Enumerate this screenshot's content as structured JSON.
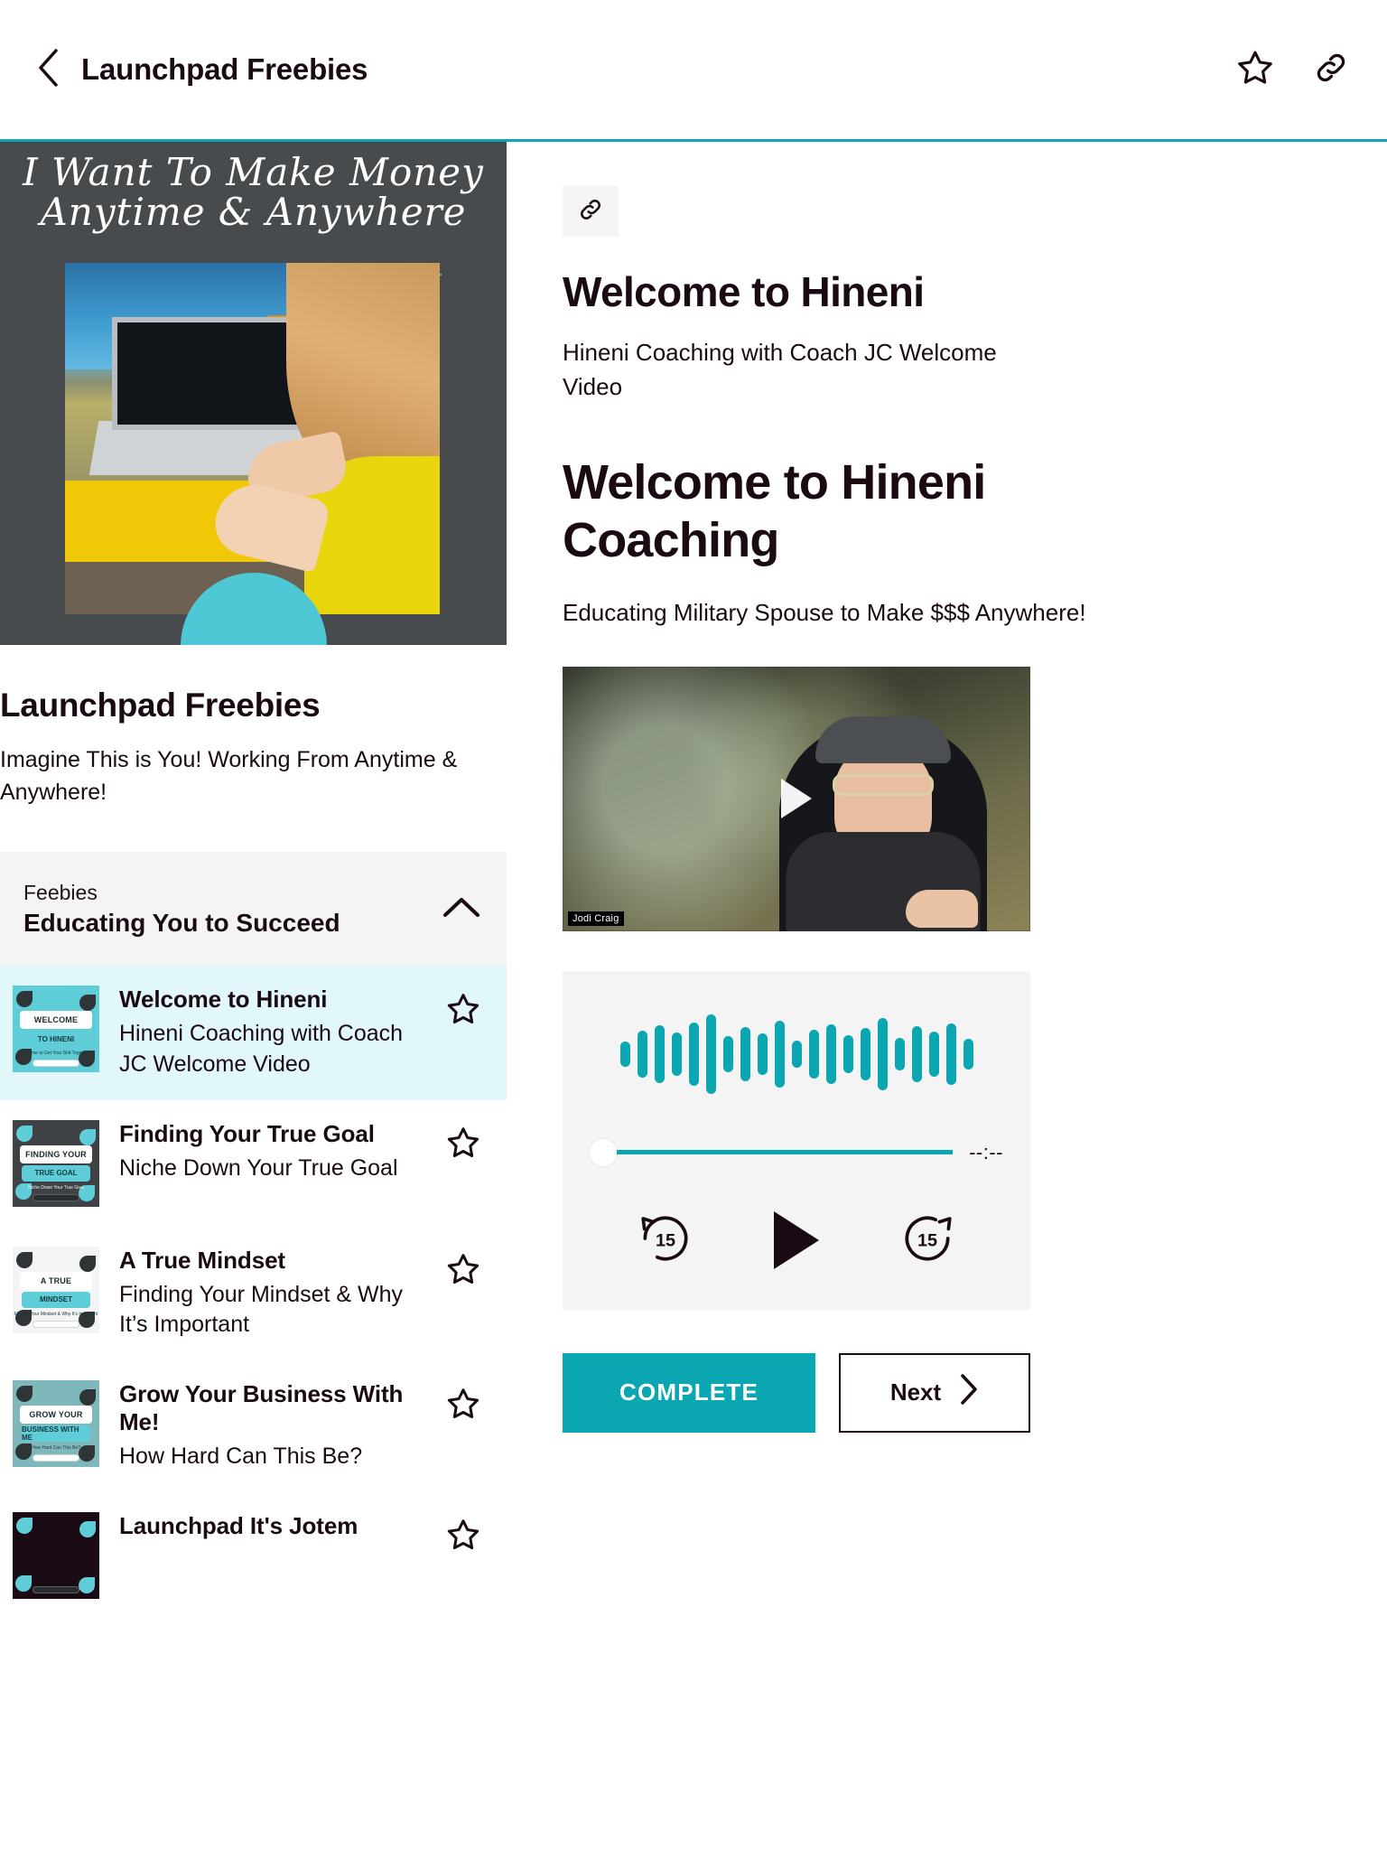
{
  "topbar": {
    "back_icon": "chevron-left-icon",
    "title": "Launchpad Freebies",
    "favorite_icon": "star-outline-icon",
    "share_icon": "link-icon"
  },
  "hero": {
    "script_line1": "I Want To Make Money",
    "script_line2": "Anytime & Anywhere"
  },
  "course": {
    "title": "Launchpad Freebies",
    "description": "Imagine This is You! Working From Anytime & Anywhere!"
  },
  "section": {
    "kicker": "Feebies",
    "name": "Educating You to Succeed",
    "collapse_icon": "chevron-up-icon"
  },
  "lessons": [
    {
      "title": "Welcome to Hineni",
      "subtitle": "Hineni Coaching with Coach JC Welcome Video",
      "thumb_line1": "WELCOME",
      "thumb_line2": "TO HINENI",
      "thumb_caption": "It's Time to Get Your Shit Together!",
      "thumb_bg": "#5ecdd8",
      "active": true,
      "star_icon": "star-outline-icon"
    },
    {
      "title": "Finding Your True Goal",
      "subtitle": "Niche Down Your True Goal",
      "thumb_line1": "FINDING YOUR",
      "thumb_line2": "TRUE GOAL",
      "thumb_caption": "Niche Down Your True Goal",
      "thumb_bg": "#3f4245",
      "active": false,
      "star_icon": "star-outline-icon"
    },
    {
      "title": "A True Mindset",
      "subtitle": "Finding Your Mindset & Why It’s Important",
      "thumb_line1": "A TRUE",
      "thumb_line2": "MINDSET",
      "thumb_caption": "Finding Your Mindset & Why It's Important",
      "thumb_bg": "#f2f4f5",
      "active": false,
      "star_icon": "star-outline-icon"
    },
    {
      "title": "Grow Your Business With Me!",
      "subtitle": "How Hard Can This Be?",
      "thumb_line1": "GROW YOUR",
      "thumb_line2": "BUSINESS WITH ME",
      "thumb_caption": "How Hard Can This Be?",
      "thumb_bg": "#7fb8bb",
      "active": false,
      "star_icon": "star-outline-icon"
    },
    {
      "title": "Launchpad It's Jotem",
      "subtitle": "",
      "thumb_line1": "",
      "thumb_line2": "",
      "thumb_caption": "",
      "thumb_bg": "#1a0a14",
      "active": false,
      "star_icon": "star-outline-icon"
    }
  ],
  "detail": {
    "link_icon": "link-icon",
    "heading": "Welcome to Hineni",
    "subtitle": "Hineni Coaching with Coach JC Welcome Video",
    "content_heading": "Welcome to Hineni Coaching",
    "content_paragraph": "Educating Military Spouse to Make $$$ Anywhere!"
  },
  "video": {
    "speaker_name": "Jodi Craig",
    "play_icon": "play-icon"
  },
  "player": {
    "time_display": "--:--",
    "rewind_label": "15",
    "forward_label": "15",
    "rewind_icon": "rewind-15-icon",
    "play_icon": "play-icon",
    "forward_icon": "forward-15-icon",
    "waveform": [
      28,
      52,
      64,
      48,
      70,
      88,
      40,
      60,
      46,
      74,
      30,
      54,
      66,
      42,
      58,
      80,
      36,
      62,
      50,
      68,
      34
    ],
    "accent_color": "#0aa7b3",
    "progress_percent": 0
  },
  "footer": {
    "complete_label": "COMPLETE",
    "next_label": "Next",
    "next_icon": "chevron-right-icon"
  }
}
